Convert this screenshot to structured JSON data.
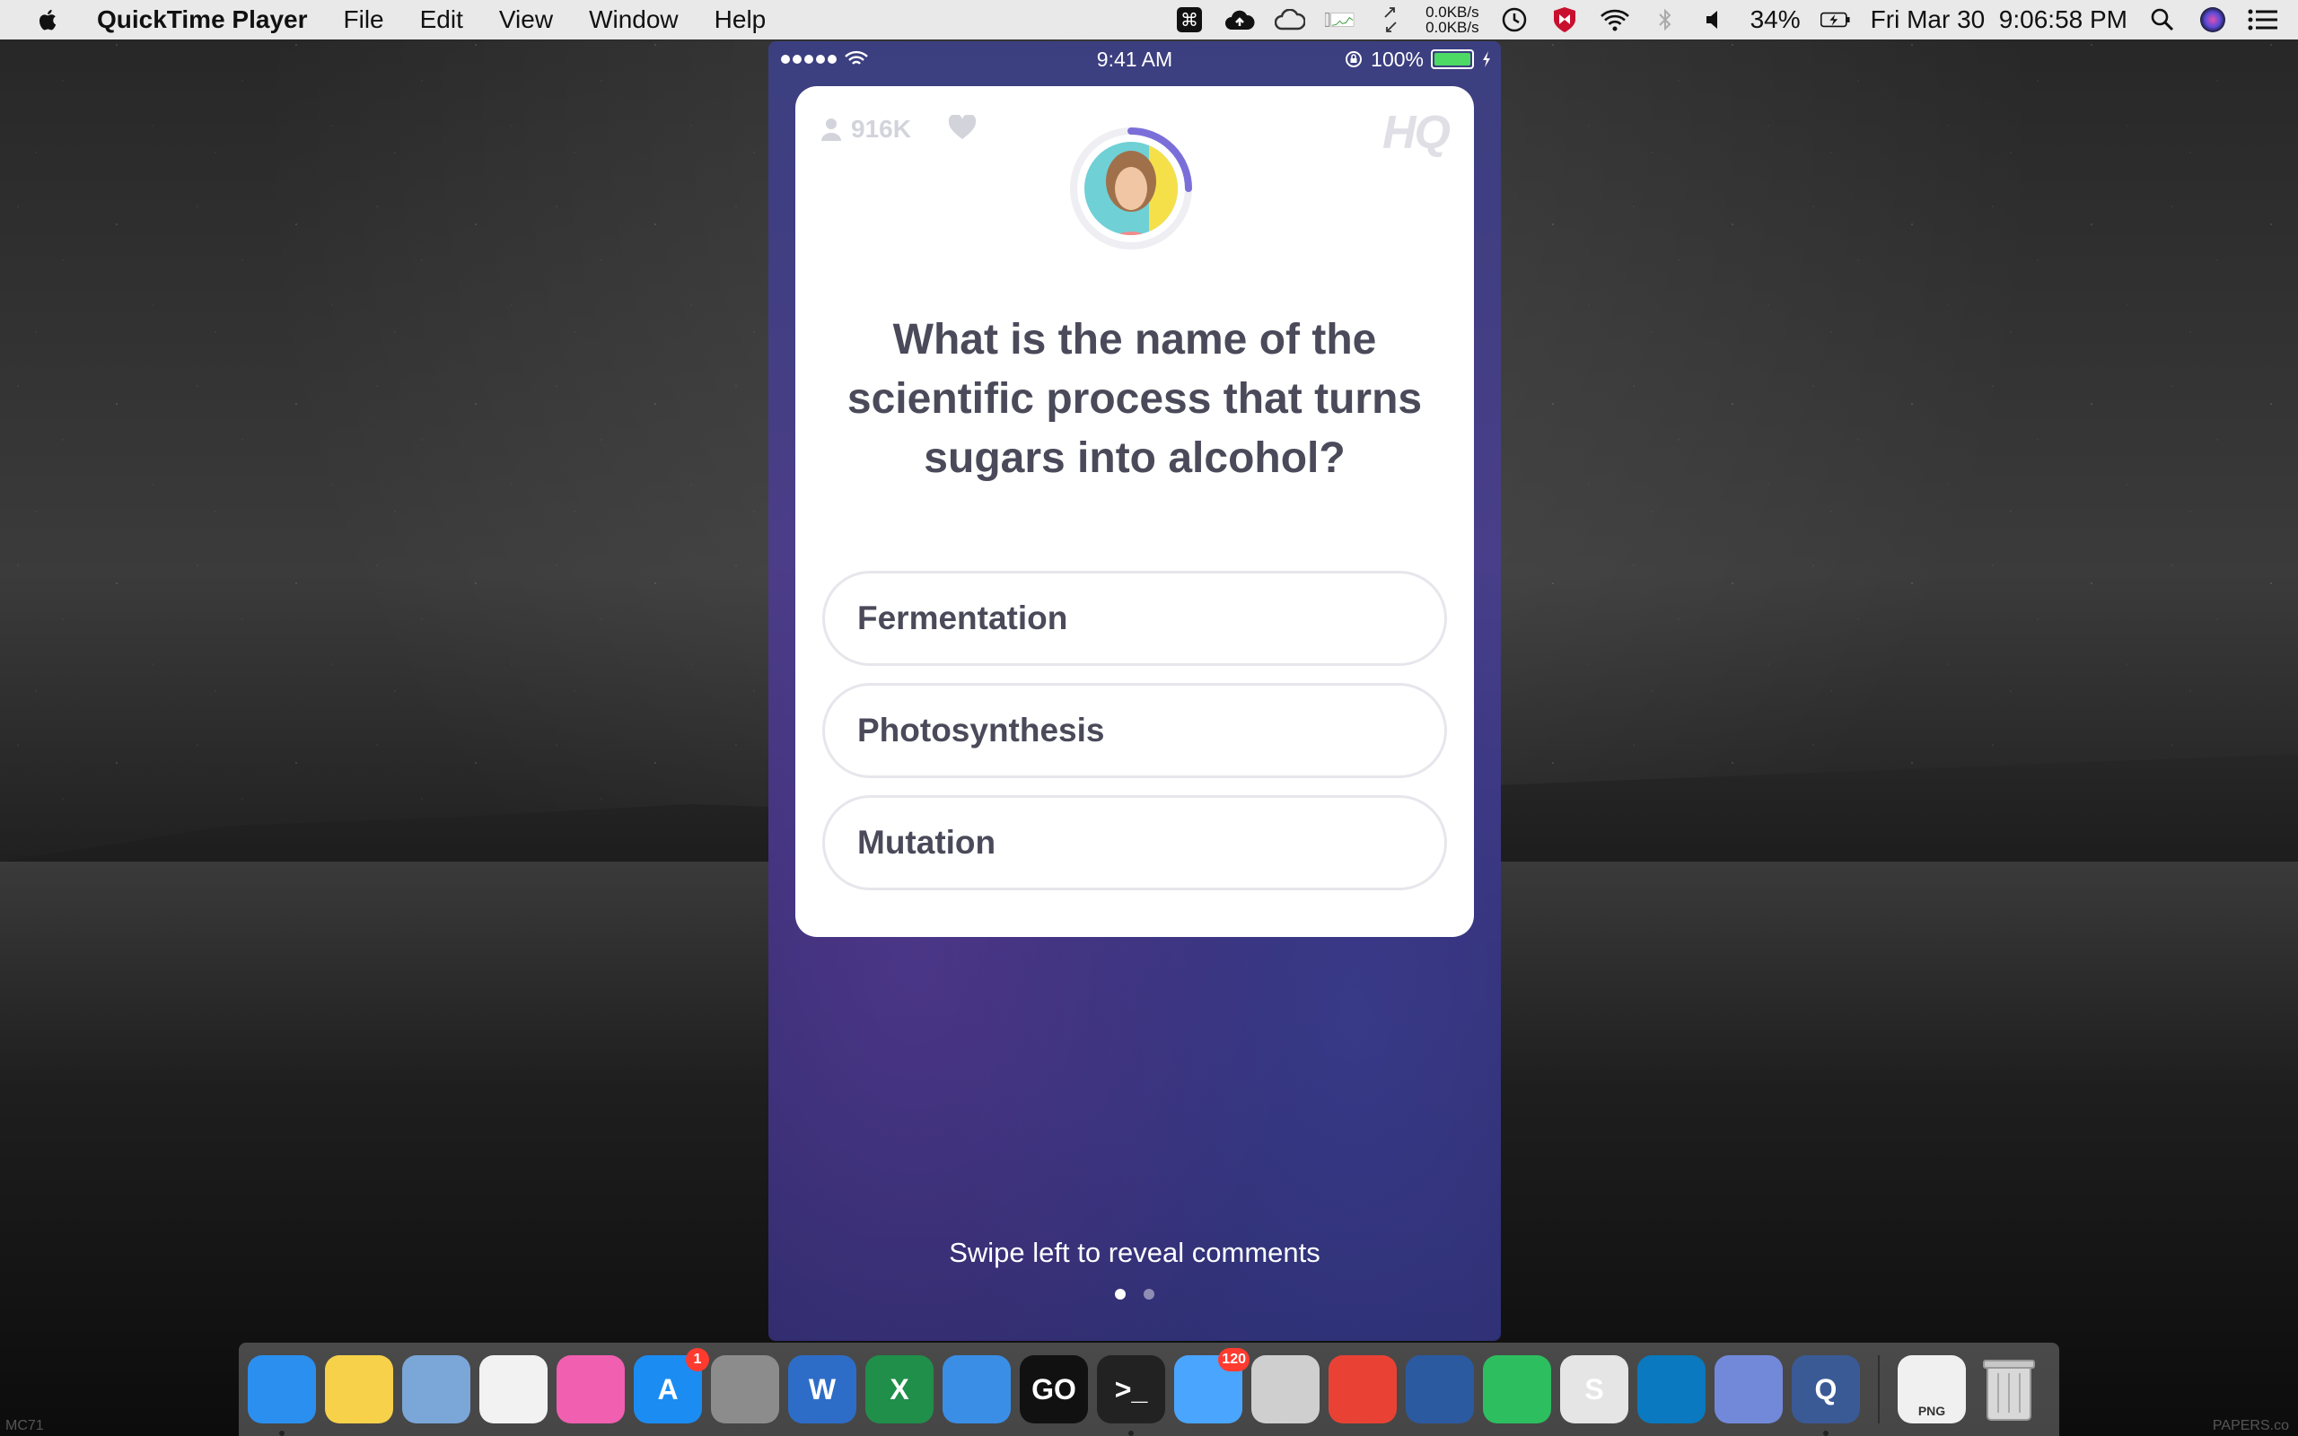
{
  "menubar": {
    "app_name": "QuickTime Player",
    "menus": [
      "File",
      "Edit",
      "View",
      "Window",
      "Help"
    ],
    "net_up": "0.0KB/s",
    "net_down": "0.0KB/s",
    "battery": "34%",
    "datetime": "Fri Mar 30  9:06:58 PM"
  },
  "phone": {
    "status": {
      "time": "9:41 AM",
      "battery": "100%"
    },
    "viewer_count": "916K",
    "logo": "HQ",
    "question": "What is the name of the scientific process that turns sugars into alcohol?",
    "answers": [
      "Fermentation",
      "Photosynthesis",
      "Mutation"
    ],
    "swipe_hint": "Swipe left to reveal comments",
    "pager": {
      "pages": 2,
      "active": 0
    }
  },
  "dock": {
    "apps": [
      {
        "name": "finder-icon",
        "color": "#2b8ff0",
        "label": "",
        "badge": "",
        "running": true
      },
      {
        "name": "notes-icon",
        "color": "#f7d14a",
        "label": "",
        "badge": "",
        "running": false
      },
      {
        "name": "preview-icon",
        "color": "#7aa6d8",
        "label": "",
        "badge": "",
        "running": false
      },
      {
        "name": "photos-icon",
        "color": "#f2f2f2",
        "label": "",
        "badge": "",
        "running": false
      },
      {
        "name": "itunes-icon",
        "color": "#f05fb0",
        "label": "",
        "badge": "",
        "running": false
      },
      {
        "name": "app-store-icon",
        "color": "#1b8cf2",
        "label": "A",
        "badge": "1",
        "running": false
      },
      {
        "name": "system-preferences-icon",
        "color": "#8c8c8c",
        "label": "",
        "badge": "",
        "running": false
      },
      {
        "name": "word-icon",
        "color": "#2d6dc7",
        "label": "W",
        "badge": "",
        "running": false
      },
      {
        "name": "excel-icon",
        "color": "#1f8f4a",
        "label": "X",
        "badge": "",
        "running": false
      },
      {
        "name": "xcode-icon",
        "color": "#3a8ee6",
        "label": "",
        "badge": "",
        "running": false
      },
      {
        "name": "goland-icon",
        "color": "#111111",
        "label": "GO",
        "badge": "",
        "running": false
      },
      {
        "name": "terminal-icon",
        "color": "#222222",
        "label": ">_",
        "badge": "",
        "running": true
      },
      {
        "name": "messages-icon",
        "color": "#4aa5ff",
        "label": "",
        "badge": "120",
        "running": false
      },
      {
        "name": "screenshot-icon",
        "color": "#cfcfcf",
        "label": "",
        "badge": "",
        "running": false
      },
      {
        "name": "chrome-icon",
        "color": "#e94235",
        "label": "",
        "badge": "",
        "running": false
      },
      {
        "name": "virtualbox-icon",
        "color": "#2c5aa0",
        "label": "",
        "badge": "",
        "running": false
      },
      {
        "name": "evernote-icon",
        "color": "#2dbe60",
        "label": "",
        "badge": "",
        "running": false
      },
      {
        "name": "scrivener-icon",
        "color": "#e5e5e5",
        "label": "S",
        "badge": "",
        "running": false
      },
      {
        "name": "trello-icon",
        "color": "#0a79bf",
        "label": "",
        "badge": "",
        "running": false
      },
      {
        "name": "discord-icon",
        "color": "#7289da",
        "label": "",
        "badge": "",
        "running": false
      },
      {
        "name": "quicktime-icon",
        "color": "#3a5a96",
        "label": "Q",
        "badge": "",
        "running": true
      }
    ],
    "stack_label": "PNG"
  },
  "wallpaper": {
    "watermark_left": "MC71",
    "watermark_right": "PAPERS.co"
  }
}
